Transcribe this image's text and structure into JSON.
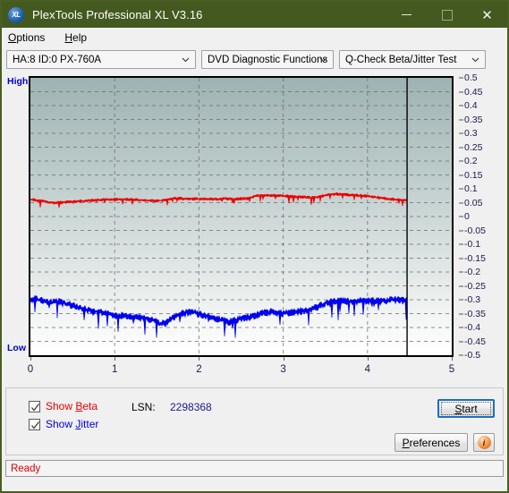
{
  "window": {
    "title": "PlexTools Professional XL V3.16",
    "app_icon": "xl-logo-icon",
    "minimize_label": "",
    "maximize_label": "",
    "close_label": "✕"
  },
  "menubar": {
    "items": [
      {
        "label": "Options",
        "accel": "O"
      },
      {
        "label": "Help",
        "accel": "H"
      }
    ]
  },
  "toolbar": {
    "drive_select": "HA:8 ID:0  PX-760A",
    "function_select": "DVD Diagnostic Functions",
    "test_select": "Q-Check Beta/Jitter Test"
  },
  "controls": {
    "show_beta_label": "Show Beta",
    "show_beta_checked": true,
    "show_jitter_label": "Show Jitter",
    "show_jitter_checked": true,
    "lsn_label": "LSN:",
    "lsn_value": "2298368",
    "start_label": "Start",
    "preferences_label": "Preferences",
    "info_label": "i"
  },
  "statusbar": {
    "text": "Ready"
  },
  "chart_data": {
    "type": "line",
    "title": "Q-Check Beta/Jitter Test",
    "xlabel": "",
    "ylabel": "",
    "xlim": [
      0,
      5
    ],
    "ylim": [
      -0.5,
      0.5
    ],
    "grid": true,
    "legend_position": "bottom-left",
    "axis_high_label": "High",
    "axis_low_label": "Low",
    "xticks": [
      0,
      1,
      2,
      3,
      4,
      5
    ],
    "xtick_labels": [
      "0",
      "1",
      "2",
      "3",
      "4",
      "5"
    ],
    "yticks": [
      0.5,
      0.45,
      0.4,
      0.35,
      0.3,
      0.25,
      0.2,
      0.15,
      0.1,
      0.05,
      0,
      -0.05,
      -0.1,
      -0.15,
      -0.2,
      -0.25,
      -0.3,
      -0.35,
      -0.4,
      -0.45,
      -0.5
    ],
    "ytick_labels": [
      "0.5",
      "0.45",
      "0.4",
      "0.35",
      "0.3",
      "0.25",
      "0.2",
      "0.15",
      "0.1",
      "0.05",
      "0",
      "-0.05",
      "-0.1",
      "-0.15",
      "-0.2",
      "-0.25",
      "-0.3",
      "-0.35",
      "-0.4",
      "-0.45",
      "-0.5"
    ],
    "data_end_x": 4.47,
    "cursor_line_x": 4.47,
    "colors": {
      "beta": "#ee0000",
      "jitter": "#0000ee",
      "grid": "#6b6b6b",
      "axis_text": "#1a1a4d"
    },
    "series": [
      {
        "name": "Beta",
        "color": "#ee0000",
        "x": [
          0.0,
          0.05,
          0.1,
          0.15,
          0.2,
          0.25,
          0.3,
          0.35,
          0.4,
          0.45,
          0.5,
          0.55,
          0.6,
          0.65,
          0.7,
          0.75,
          0.8,
          0.85,
          0.9,
          0.95,
          1.0,
          1.05,
          1.1,
          1.15,
          1.2,
          1.25,
          1.3,
          1.35,
          1.4,
          1.45,
          1.5,
          1.55,
          1.6,
          1.65,
          1.7,
          1.75,
          1.8,
          1.85,
          1.9,
          1.95,
          2.0,
          2.05,
          2.1,
          2.15,
          2.2,
          2.25,
          2.3,
          2.35,
          2.4,
          2.45,
          2.5,
          2.55,
          2.6,
          2.65,
          2.7,
          2.75,
          2.8,
          2.85,
          2.9,
          2.95,
          3.0,
          3.05,
          3.1,
          3.15,
          3.2,
          3.25,
          3.3,
          3.35,
          3.4,
          3.45,
          3.5,
          3.55,
          3.6,
          3.65,
          3.7,
          3.75,
          3.8,
          3.85,
          3.9,
          3.95,
          4.0,
          4.05,
          4.1,
          4.15,
          4.2,
          4.25,
          4.3,
          4.35,
          4.4,
          4.45,
          4.47
        ],
        "y": [
          0.062,
          0.06,
          0.058,
          0.055,
          0.052,
          0.05,
          0.05,
          0.051,
          0.052,
          0.053,
          0.054,
          0.055,
          0.056,
          0.057,
          0.058,
          0.059,
          0.06,
          0.061,
          0.061,
          0.062,
          0.062,
          0.062,
          0.062,
          0.062,
          0.062,
          0.061,
          0.06,
          0.059,
          0.058,
          0.057,
          0.057,
          0.058,
          0.06,
          0.063,
          0.066,
          0.066,
          0.065,
          0.064,
          0.064,
          0.064,
          0.064,
          0.064,
          0.063,
          0.063,
          0.063,
          0.063,
          0.064,
          0.064,
          0.064,
          0.064,
          0.065,
          0.065,
          0.066,
          0.072,
          0.075,
          0.076,
          0.076,
          0.076,
          0.076,
          0.076,
          0.075,
          0.074,
          0.073,
          0.072,
          0.071,
          0.07,
          0.069,
          0.069,
          0.07,
          0.074,
          0.078,
          0.08,
          0.081,
          0.081,
          0.08,
          0.079,
          0.078,
          0.077,
          0.076,
          0.075,
          0.074,
          0.072,
          0.07,
          0.068,
          0.066,
          0.064,
          0.062,
          0.061,
          0.06,
          0.06,
          0.06
        ],
        "noise_amplitude": 0.012,
        "mean": 0.065
      },
      {
        "name": "Jitter",
        "color": "#0000ee",
        "x": [
          0.0,
          0.05,
          0.1,
          0.15,
          0.2,
          0.25,
          0.3,
          0.35,
          0.4,
          0.45,
          0.5,
          0.55,
          0.6,
          0.65,
          0.7,
          0.75,
          0.8,
          0.85,
          0.9,
          0.95,
          1.0,
          1.05,
          1.1,
          1.15,
          1.2,
          1.25,
          1.3,
          1.35,
          1.4,
          1.45,
          1.5,
          1.55,
          1.6,
          1.65,
          1.7,
          1.75,
          1.8,
          1.85,
          1.9,
          1.95,
          2.0,
          2.05,
          2.1,
          2.15,
          2.2,
          2.25,
          2.3,
          2.35,
          2.4,
          2.45,
          2.5,
          2.55,
          2.6,
          2.65,
          2.7,
          2.75,
          2.8,
          2.85,
          2.9,
          2.95,
          3.0,
          3.05,
          3.1,
          3.15,
          3.2,
          3.25,
          3.3,
          3.35,
          3.4,
          3.45,
          3.5,
          3.55,
          3.6,
          3.65,
          3.7,
          3.75,
          3.8,
          3.85,
          3.9,
          3.95,
          4.0,
          4.05,
          4.1,
          4.15,
          4.2,
          4.25,
          4.3,
          4.35,
          4.4,
          4.45,
          4.47
        ],
        "y": [
          -0.3,
          -0.295,
          -0.3,
          -0.305,
          -0.308,
          -0.31,
          -0.306,
          -0.305,
          -0.31,
          -0.315,
          -0.32,
          -0.325,
          -0.33,
          -0.333,
          -0.336,
          -0.34,
          -0.343,
          -0.346,
          -0.35,
          -0.352,
          -0.355,
          -0.356,
          -0.357,
          -0.358,
          -0.36,
          -0.362,
          -0.364,
          -0.366,
          -0.368,
          -0.372,
          -0.38,
          -0.385,
          -0.382,
          -0.372,
          -0.36,
          -0.352,
          -0.348,
          -0.346,
          -0.345,
          -0.346,
          -0.35,
          -0.354,
          -0.358,
          -0.362,
          -0.366,
          -0.37,
          -0.374,
          -0.378,
          -0.376,
          -0.372,
          -0.368,
          -0.364,
          -0.362,
          -0.358,
          -0.352,
          -0.348,
          -0.344,
          -0.342,
          -0.344,
          -0.346,
          -0.348,
          -0.346,
          -0.344,
          -0.342,
          -0.34,
          -0.338,
          -0.336,
          -0.332,
          -0.326,
          -0.318,
          -0.312,
          -0.308,
          -0.306,
          -0.305,
          -0.304,
          -0.305,
          -0.306,
          -0.305,
          -0.304,
          -0.303,
          -0.302,
          -0.303,
          -0.304,
          -0.303,
          -0.302,
          -0.301,
          -0.3,
          -0.3,
          -0.301,
          -0.302,
          -0.302
        ],
        "noise_amplitude": 0.03,
        "mean": -0.335
      }
    ]
  }
}
